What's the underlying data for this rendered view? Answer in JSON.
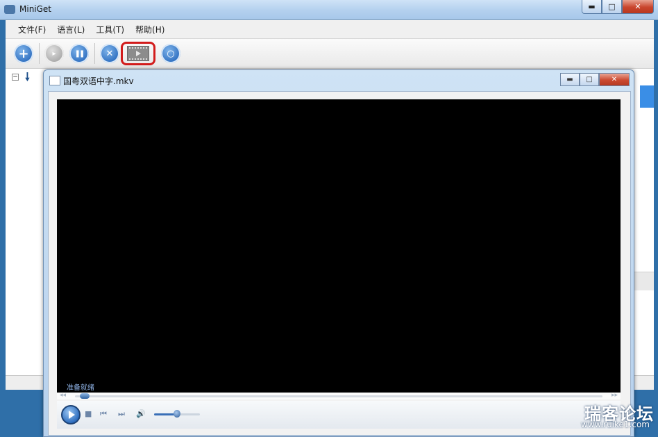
{
  "main_window": {
    "title": "MiniGet",
    "caption_buttons": {
      "minimize": "▬",
      "maximize": "□",
      "close": "✕"
    }
  },
  "menu": {
    "items": [
      "文件(F)",
      "语言(L)",
      "工具(T)",
      "帮助(H)"
    ]
  },
  "toolbar": {
    "add": "+",
    "start": "▸",
    "pause": "❚❚",
    "delete": "✕",
    "settings": "○",
    "icons": [
      "add-icon",
      "start-icon",
      "pause-icon",
      "delete-icon",
      "video-play-icon",
      "settings-icon"
    ]
  },
  "task_tree": {
    "collapse_glyph": "−",
    "download_glyph": "🠗"
  },
  "player": {
    "title": "国粤双语中字.mkv",
    "caption_buttons": {
      "minimize": "▬",
      "maximize": "□",
      "close": "✕"
    },
    "status": "准备就绪",
    "seek_back_glyph": "◂◂",
    "seek_forward_glyph": "▸▸",
    "controls": {
      "stop": "■",
      "prev": "⏮",
      "next": "⏭",
      "volume": "🔊"
    },
    "seek_position": 0.01,
    "volume_level": 0.5
  },
  "watermark": {
    "main": "瑞客论坛",
    "sub": "www.ruike1.com"
  },
  "colors": {
    "highlight_border": "#d21c1c",
    "video_bg": "#000000",
    "status_text": "#8fb3e6"
  }
}
